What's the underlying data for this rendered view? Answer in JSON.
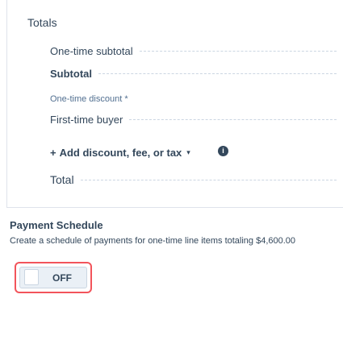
{
  "totals": {
    "title": "Totals",
    "one_time_subtotal": "One-time subtotal",
    "subtotal": "Subtotal",
    "one_time_discount": "One-time discount *",
    "first_time_buyer": "First-time buyer",
    "add_link_plus": "+",
    "add_link_label": "Add discount, fee, or tax",
    "chevron": "▾",
    "info": "i",
    "total": "Total"
  },
  "payment_schedule": {
    "title": "Payment Schedule",
    "description": "Create a schedule of payments for one-time line items totaling $4,600.00",
    "toggle_label": "OFF"
  }
}
